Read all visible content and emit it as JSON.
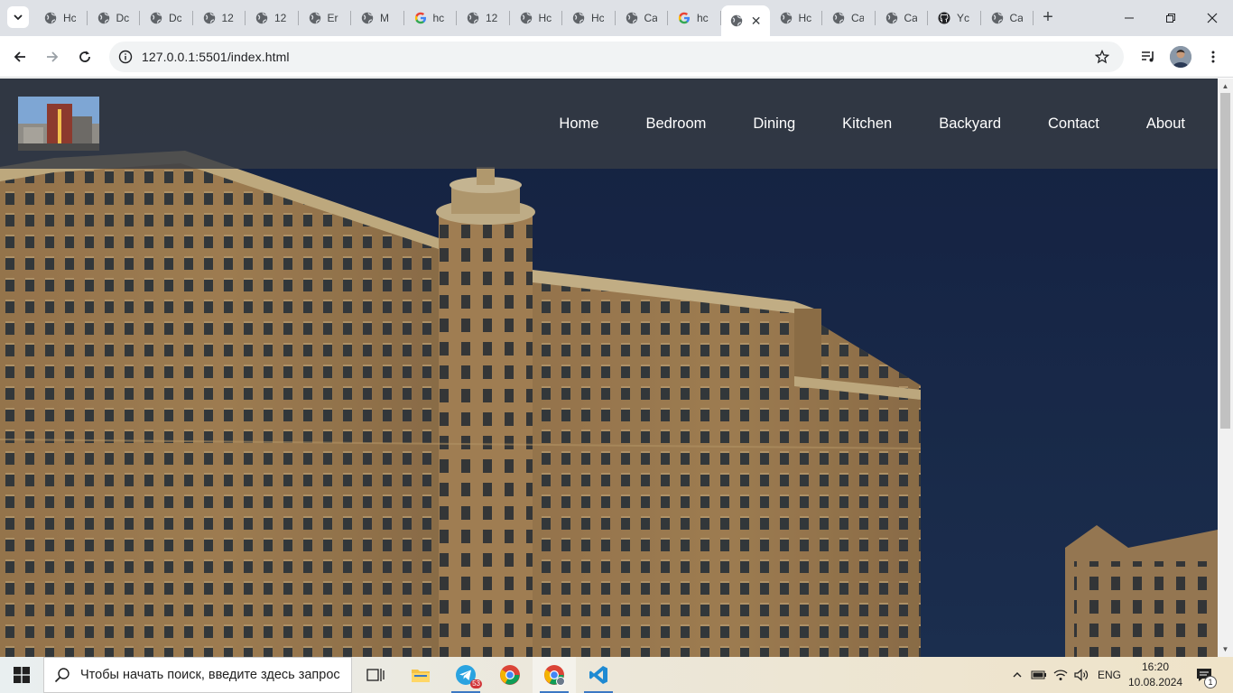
{
  "browser": {
    "tabs": [
      {
        "label": "Hc",
        "favicon": "globe-icon"
      },
      {
        "label": "Dc",
        "favicon": "globe-icon"
      },
      {
        "label": "Dc",
        "favicon": "globe-icon"
      },
      {
        "label": "12",
        "favicon": "globe-icon"
      },
      {
        "label": "12",
        "favicon": "globe-icon"
      },
      {
        "label": "Er",
        "favicon": "globe-icon"
      },
      {
        "label": "M",
        "favicon": "globe-icon"
      },
      {
        "label": "hc",
        "favicon": "google-icon"
      },
      {
        "label": "12",
        "favicon": "globe-icon"
      },
      {
        "label": "Hc",
        "favicon": "globe-icon"
      },
      {
        "label": "Hc",
        "favicon": "globe-icon"
      },
      {
        "label": "Ca",
        "favicon": "globe-icon"
      },
      {
        "label": "hc",
        "favicon": "google-icon"
      },
      {
        "label": "",
        "favicon": "globe-icon",
        "active": true
      },
      {
        "label": "Hc",
        "favicon": "globe-icon"
      },
      {
        "label": "Ca",
        "favicon": "globe-icon"
      },
      {
        "label": "Ca",
        "favicon": "globe-icon"
      },
      {
        "label": "Yc",
        "favicon": "github-icon"
      },
      {
        "label": "Ca",
        "favicon": "globe-icon"
      }
    ],
    "address": "127.0.0.1:5501/index.html"
  },
  "site": {
    "nav": [
      "Home",
      "Bedroom",
      "Dining",
      "Kitchen",
      "Backyard",
      "Contact",
      "About"
    ]
  },
  "taskbar": {
    "search_placeholder": "Чтобы начать поиск, введите здесь запрос",
    "telegram_badge": "53",
    "language": "ENG",
    "time": "16:20",
    "date": "10.08.2024",
    "notification_count": "1"
  },
  "colors": {
    "header_bg": "#3a3f46",
    "sky": "#1d2f52",
    "building": "#b08a58",
    "accent": "#3b78c4"
  }
}
